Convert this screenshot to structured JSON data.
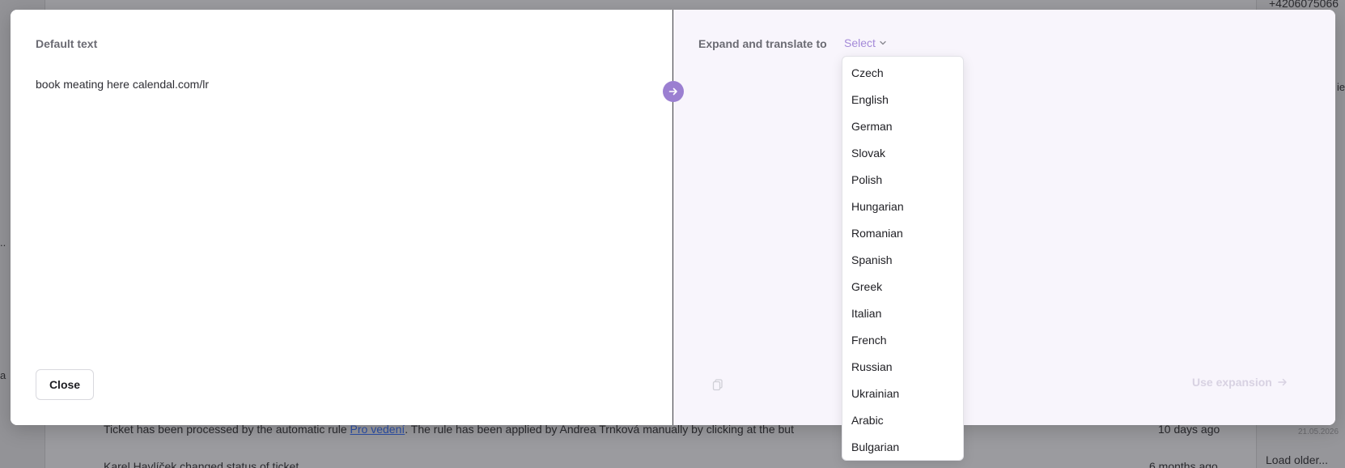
{
  "background": {
    "phone": "+4206075066",
    "edge_text_1": "..",
    "edge_text_2": "a",
    "edge_text_3": "ie",
    "activity_1": {
      "prefix": "Ticket has been processed by the automatic rule ",
      "link": "Pro vedení",
      "suffix": ". The rule has been applied by Andrea Trnková manually by clicking at the but"
    },
    "activity_1_time": "10 days ago",
    "activity_2": "Karel Havlíček changed status of ticket",
    "activity_2_time": "6 months ago",
    "load_older": "Load older...",
    "date": "21.05.2026"
  },
  "modal": {
    "default_label": "Default text",
    "default_value": "book meating here calendal.com/lr",
    "close_label": "Close",
    "expand_label": "Expand and translate to",
    "select_placeholder": "Select",
    "use_expansion_label": "Use expansion",
    "languages": [
      "Czech",
      "English",
      "German",
      "Slovak",
      "Polish",
      "Hungarian",
      "Romanian",
      "Spanish",
      "Greek",
      "Italian",
      "French",
      "Russian",
      "Ukrainian",
      "Arabic",
      "Bulgarian"
    ]
  },
  "colors": {
    "accent": "#9b7fd1",
    "right_pane_bg": "#f8f5fc"
  }
}
